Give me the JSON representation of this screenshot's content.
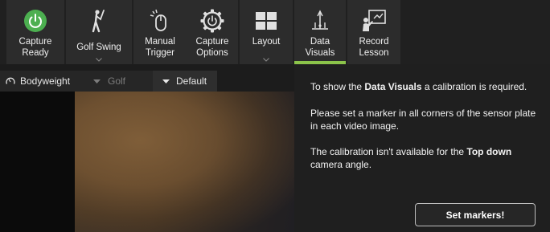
{
  "toolbar": {
    "buttons": [
      {
        "id": "capture-ready",
        "label": "Capture Ready",
        "icon": "power-icon",
        "accent": "#4caf50"
      },
      {
        "id": "golf-swing",
        "label": "Golf Swing",
        "icon": "golfer-icon",
        "has_dropdown": true
      },
      {
        "id": "manual-trigger",
        "label": "Manual Trigger",
        "icon": "mouse-click-icon"
      },
      {
        "id": "capture-options",
        "label": "Capture Options",
        "icon": "gear-power-icon"
      },
      {
        "id": "layout",
        "label": "Layout",
        "icon": "grid-layout-icon",
        "has_dropdown": true
      },
      {
        "id": "data-visuals",
        "label": "Data Visuals",
        "icon": "data-visuals-icon",
        "active": true,
        "active_color": "#8bc34a"
      },
      {
        "id": "record-lesson",
        "label": "Record Lesson",
        "icon": "presenter-board-icon"
      }
    ]
  },
  "filters": {
    "bodyweight": "Bodyweight",
    "golf": "Golf",
    "default": "Default"
  },
  "info": {
    "line1_pre": "To show the ",
    "line1_bold": "Data Visuals",
    "line1_post": " a calibration is required.",
    "line2": "Please set a marker in all corners of the sensor plate in each video image.",
    "line3_pre": "The calibration isn't available for the ",
    "line3_bold": "Top down",
    "line3_post": " camera angle."
  },
  "set_markers_label": "Set markers!"
}
